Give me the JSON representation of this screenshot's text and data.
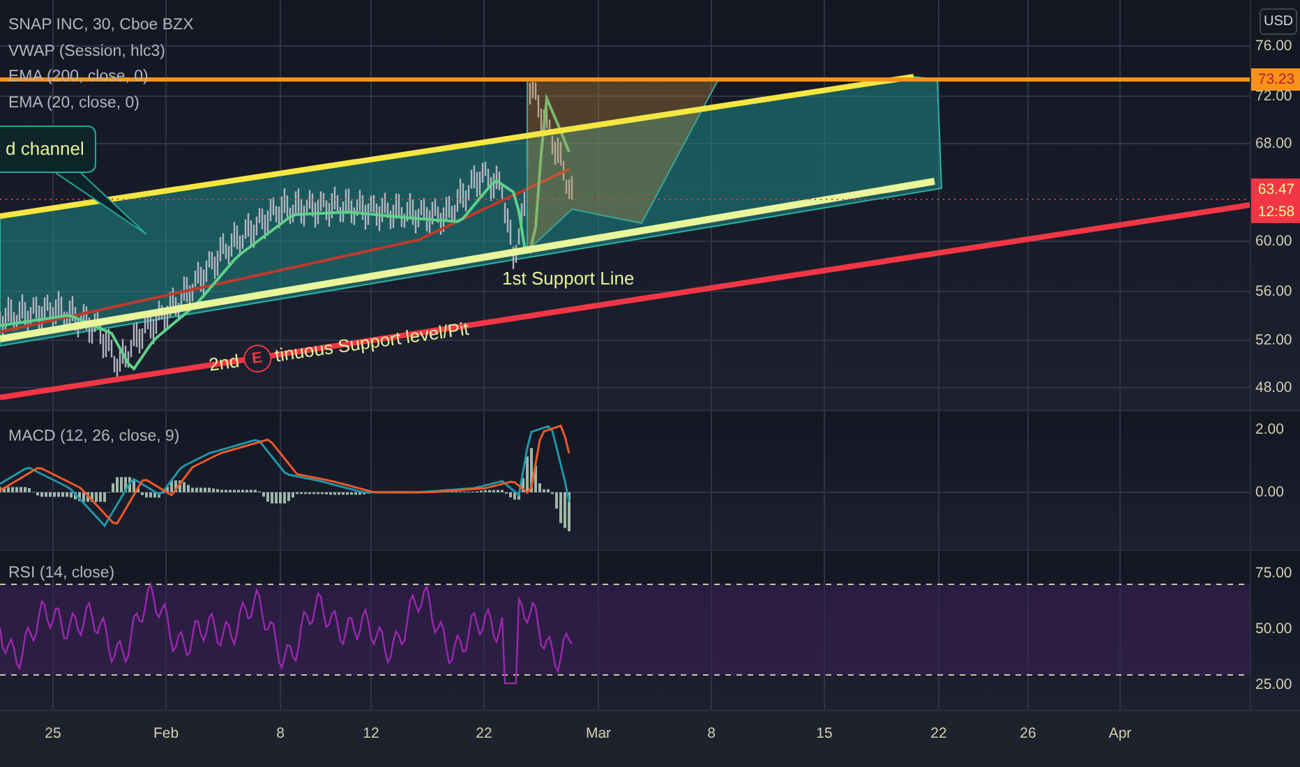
{
  "legend": [
    "SNAP INC, 30, Cboe BZX",
    "VWAP (Session, hlc3)",
    "EMA (200, close, 0)",
    "EMA (20, close, 0)"
  ],
  "currency": "USD",
  "price_axis": [
    "76.00",
    "72.00",
    "68.00",
    "60.00",
    "56.00",
    "52.00",
    "48.00"
  ],
  "price_tags": [
    {
      "kind": "single",
      "lines": [
        "73.23"
      ],
      "color": "#f7931a"
    },
    {
      "kind": "double",
      "lines": [
        "63.47",
        "12:58"
      ],
      "color": "#f23645"
    }
  ],
  "annotations": {
    "callout": "d channel",
    "support_1": "1st Support Line",
    "support_2_start": "2nd",
    "marker": "E",
    "support_2_end": "tinuous Support level/Pit"
  },
  "macd": {
    "label": "MACD (12, 26, close, 9)",
    "axis": [
      "2.00",
      "0.00"
    ]
  },
  "rsi": {
    "label": "RSI (14, close)",
    "axis": [
      "75.00",
      "50.00",
      "25.00"
    ]
  },
  "time_axis": [
    "25",
    "Feb",
    "8",
    "12",
    "22",
    "Mar",
    "8",
    "15",
    "22",
    "26",
    "Apr"
  ]
}
